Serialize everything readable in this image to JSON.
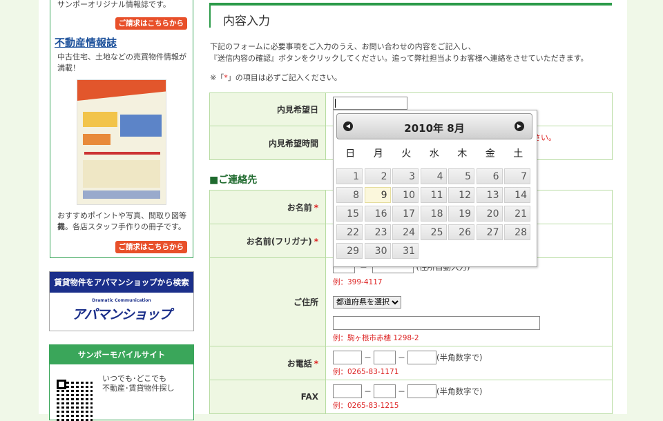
{
  "sidebar": {
    "original_mag_text": "サンポーオリジナル情報誌です。",
    "request_label": "ご請求はこちらから",
    "realestate_title": "不動産情報誌",
    "realestate_desc1": "中古住宅、土地などの売買物件情報が",
    "realestate_desc2": "満載！",
    "realestate_desc3": "おすすめポイントや写真、間取り図等掲",
    "realestate_desc4": "載。各店スタッフ手作りの冊子です。",
    "banner_top": "賃貸物件をアパマンショップから検索",
    "banner_small": "Dramatic Communication",
    "banner_logo": "アパマンショップ",
    "mobile_title": "サンポーモバイルサイト",
    "mobile_text1": "いつでも･どこでも",
    "mobile_text2": "不動産･賃貸物件探し"
  },
  "main": {
    "title": "内容入力",
    "intro1": "下記のフォームに必要事項をご入力のうえ、お問い合わせの内容をご記入し、",
    "intro2": "『送信内容の確認』ボタンをクリックしてください。追って弊社担当よりお客様へ連絡をさせていただきます。",
    "note_pre": "※「",
    "note_ast": "*",
    "note_post": "」の項目は必ずご記入ください。",
    "section_contact": "■ご連絡先",
    "required_mark": "*",
    "fields": {
      "visit_date": "内見希望日",
      "visit_time": "内見希望時間",
      "visit_time_note": "さい。",
      "name": "お名前",
      "name_kana": "お名前(フリガナ)",
      "address": "ご住所",
      "address_hint": "(住所自動入力)",
      "postal_example": "例：399-4117",
      "prefecture_select": "都道府県を選択",
      "address_example": "例：駒ヶ根市赤穂 1298-2",
      "phone": "お電話",
      "phone_hint": "(半角数字で)",
      "phone_example": "例：0265-83-1171",
      "fax": "FAX",
      "fax_hint": "(半角数字で)",
      "fax_example": "例：0265-83-1215",
      "dash": "－"
    }
  },
  "calendar": {
    "title": "2010年 8月",
    "prev": "◀",
    "next": "▶",
    "weekdays": [
      "日",
      "月",
      "火",
      "水",
      "木",
      "金",
      "土"
    ],
    "days": [
      "1",
      "2",
      "3",
      "4",
      "5",
      "6",
      "7",
      "8",
      "9",
      "10",
      "11",
      "12",
      "13",
      "14",
      "15",
      "16",
      "17",
      "18",
      "19",
      "20",
      "21",
      "22",
      "23",
      "24",
      "25",
      "26",
      "27",
      "28",
      "29",
      "30",
      "31"
    ],
    "today": "9"
  }
}
